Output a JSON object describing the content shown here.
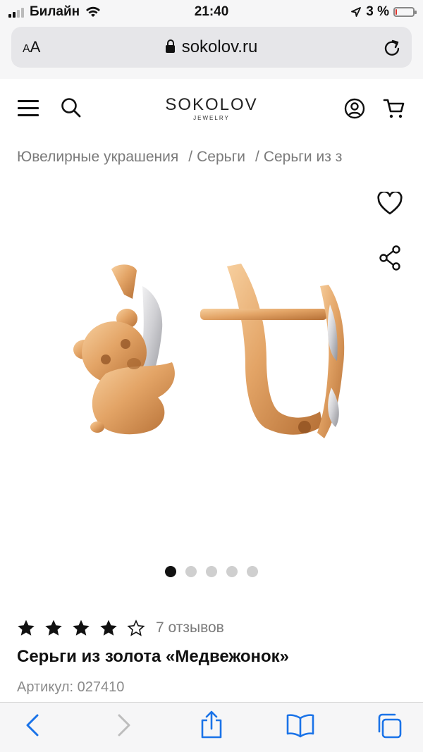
{
  "status_bar": {
    "carrier": "Билайн",
    "time": "21:40",
    "battery_percent": "3 %"
  },
  "browser": {
    "text_size_label_small": "A",
    "text_size_label_large": "A",
    "url": "sokolov.ru"
  },
  "header": {
    "logo_main": "SOKOLOV",
    "logo_sub": "JEWELRY"
  },
  "breadcrumb": {
    "items": [
      "Ювелирные украшения",
      "Серьги",
      "Серьги из з"
    ],
    "separator": "/"
  },
  "gallery": {
    "image_count": 5,
    "active_index": 0
  },
  "product": {
    "rating": 4,
    "rating_max": 5,
    "reviews_label": "7 отзывов",
    "title": "Серьги из золота «Медвежонок»",
    "sku_label": "Артикул: 027410"
  },
  "colors": {
    "accent_ios": "#1a73e8",
    "text_primary": "#111111",
    "text_muted": "#7b7b7b",
    "gold": "#d99a5c"
  },
  "icons": {
    "menu": "hamburger-icon",
    "search": "search-icon",
    "account": "user-icon",
    "cart": "cart-icon",
    "favorite": "heart-icon",
    "share": "share-icon"
  }
}
